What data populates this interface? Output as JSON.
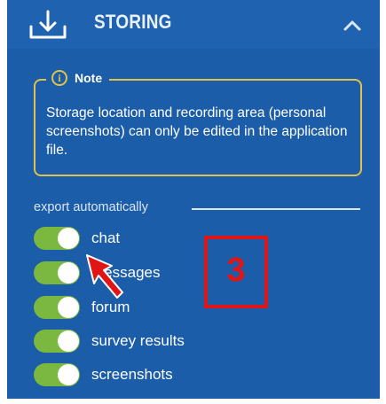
{
  "header": {
    "title": "STORING",
    "icon": "download-icon",
    "collapse_icon": "chevron-up-icon"
  },
  "note": {
    "title": "Note",
    "icon": "info-icon",
    "icon_glyph": "i",
    "text": "Storage location and recording area (personal screenshots) can only be edited in the application file."
  },
  "export": {
    "section_label": "export automatically",
    "toggles": [
      {
        "label": "chat",
        "on": true
      },
      {
        "label": "messages",
        "on": true
      },
      {
        "label": "forum",
        "on": true
      },
      {
        "label": "survey results",
        "on": true
      },
      {
        "label": "screenshots",
        "on": true
      }
    ]
  },
  "annotation": {
    "number": "3"
  },
  "colors": {
    "panel": "#1b5da8",
    "note_border": "#e2c14a",
    "toggle_on": "#7ab840",
    "annotation": "#e01515"
  }
}
